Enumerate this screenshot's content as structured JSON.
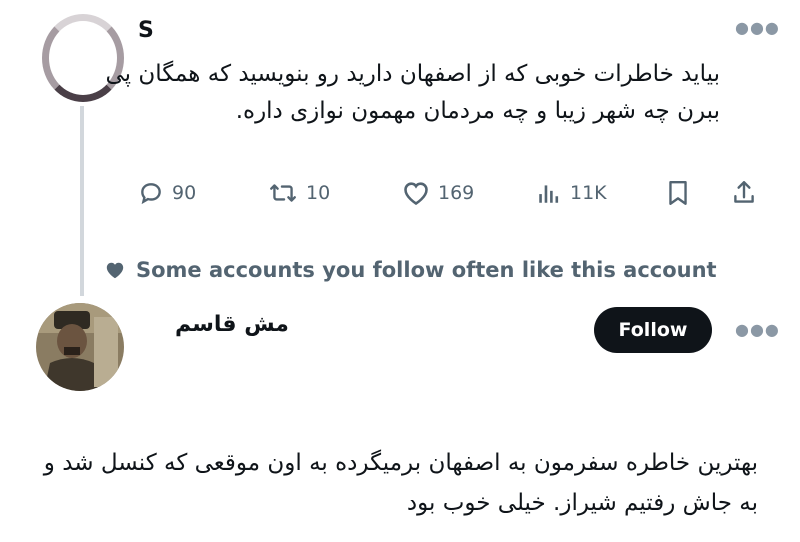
{
  "tweet1": {
    "handle": "S",
    "text": "بیاید خاطرات خوبی که از اصفهان دارید رو بنویسید که همگان پی ببرن چه شهر زیبا و چه مردمان مهمون نوازی داره.",
    "replies": "90",
    "retweets": "10",
    "likes": "169",
    "views": "11K"
  },
  "social_context": {
    "text": "Some accounts you follow often like this account"
  },
  "tweet2": {
    "name": "مش قاسم",
    "follow_label": "Follow",
    "text": "بهترین خاطره سفرمون به اصفهان برمیگرده به اون موقعی که کنسل شد و به جاش رفتیم شیراز. خیلی خوب بود"
  },
  "colors": {
    "text": "#0f1419",
    "muted": "#536471",
    "button_bg": "#0f1419",
    "thread_line": "#d2d7dc"
  }
}
